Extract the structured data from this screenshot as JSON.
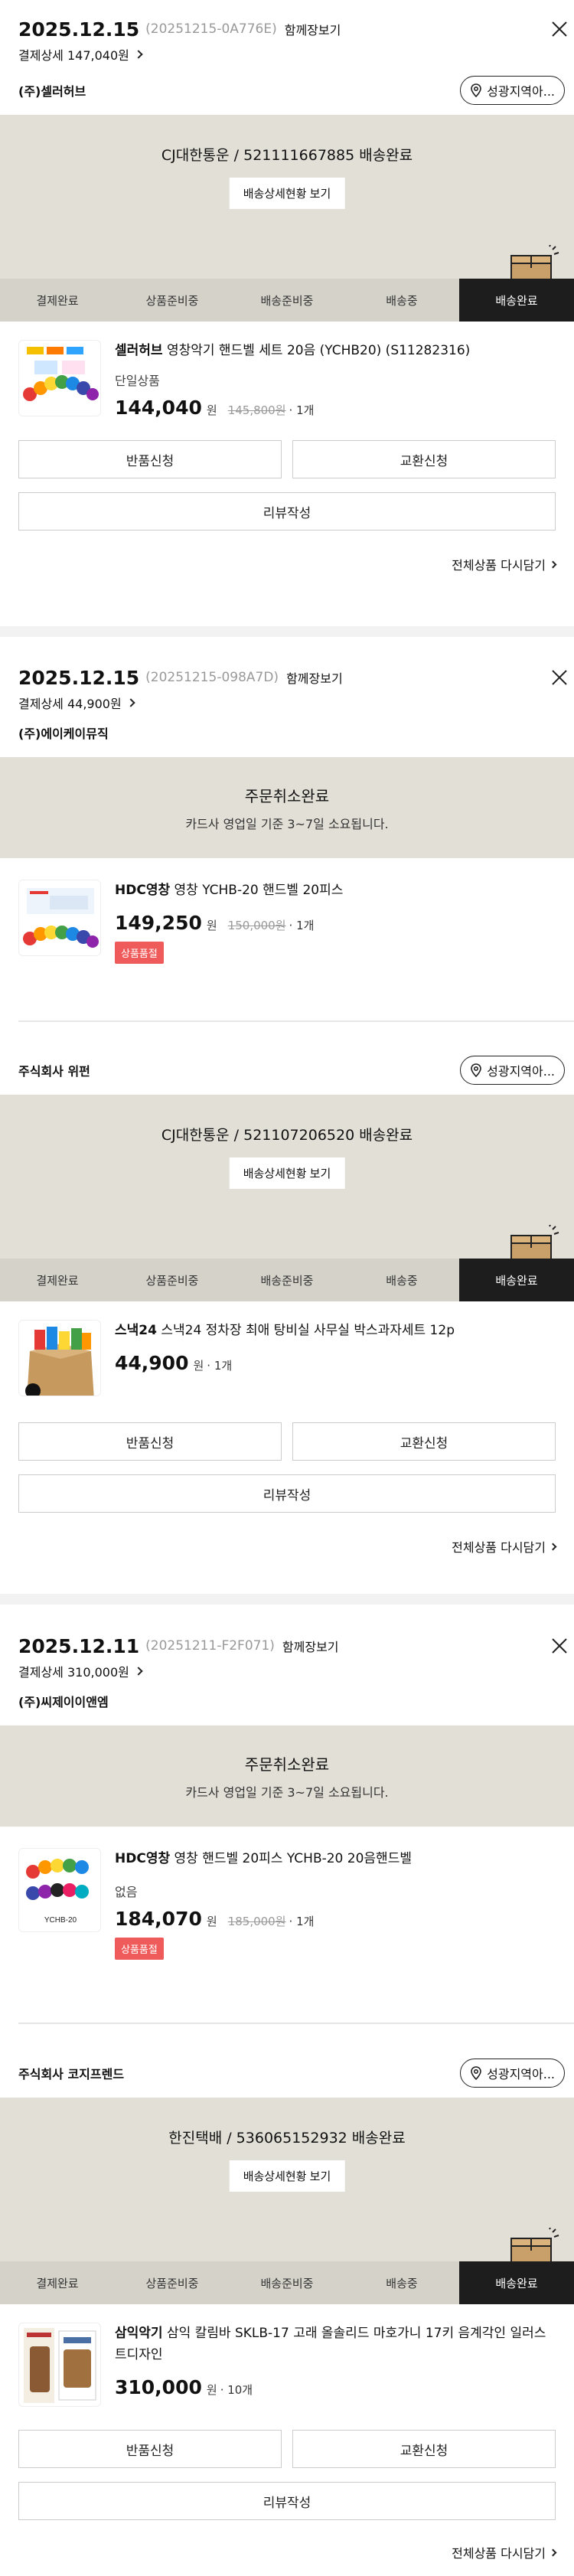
{
  "orders": [
    {
      "date": "2025.12.15",
      "order_id": "(20251215-0A776E)",
      "together": "함께장보기",
      "payment": "결제상세 147,040원"
    },
    {
      "date": "2025.12.15",
      "order_id": "(20251215-098A7D)",
      "together": "함께장보기",
      "payment": "결제상세 44,900원"
    },
    {
      "date": "2025.12.11",
      "order_id": "(20251211-F2F071)",
      "together": "함께장보기",
      "payment": "결제상세 310,000원"
    }
  ],
  "location_button": "성광지역아...",
  "ship_detail_button": "배송상세현황 보기",
  "steps": [
    "결제완료",
    "상품준비중",
    "배송준비중",
    "배송중",
    "배송완료"
  ],
  "actions": {
    "return": "반품신청",
    "exchange": "교환신청",
    "review": "리뷰작성",
    "reorder": "전체상품 다시담기"
  },
  "cancel": {
    "title": "주문취소완료",
    "subtitle": "카드사 영업일 기준 3~7일 소요됩니다."
  },
  "shipments": [
    {
      "seller": "(주)셀러허브",
      "carrier_status": "CJ대한통운 / 521111667885 배송완료",
      "product_brand": "셀러허브",
      "product_name": "영창악기 핸드벨 세트 20음 (YCHB20) (S11282316)",
      "option": "단일상품",
      "price": "144,040",
      "won": "원",
      "original": "145,800원",
      "qty": "· 1개"
    },
    {
      "seller": "(주)에이케이뮤직",
      "product_brand": "HDC영창",
      "product_name": "영창 YCHB-20 핸드벨 20피스",
      "price": "149,250",
      "won": "원",
      "original": "150,000원",
      "qty": "· 1개",
      "badge": "상품품절"
    },
    {
      "seller": "주식회사 위펀",
      "carrier_status": "CJ대한통운 / 521107206520 배송완료",
      "product_brand": "스낵24",
      "product_name": "스낵24 정차장 최애 탕비실 사무실 박스과자세트 12p",
      "price": "44,900",
      "won": "원",
      "qty": "· 1개"
    },
    {
      "seller": "(주)씨제이이앤엠",
      "product_brand": "HDC영창",
      "product_name": "영창 핸드벨 20피스 YCHB-20 20음핸드벨",
      "option": "없음",
      "price": "184,070",
      "won": "원",
      "original": "185,000원",
      "qty": "· 1개",
      "badge": "상품품절"
    },
    {
      "seller": "주식회사 코지프렌드",
      "carrier_status": "한진택배 / 536065152932 배송완료",
      "product_brand": "삼익악기",
      "product_name": "삼익 칼림바 SKLB-17 고래 올솔리드 마호가니 17키 음계각인 일러스트디자인",
      "price": "310,000",
      "won": "원",
      "qty": "· 10개"
    }
  ],
  "thumb_labels": {
    "ychb": "YCHB-20"
  },
  "colors": {
    "panel": "#e2dfd7",
    "active_step": "#1d1d1d",
    "soldout": "#ef5a5a"
  }
}
